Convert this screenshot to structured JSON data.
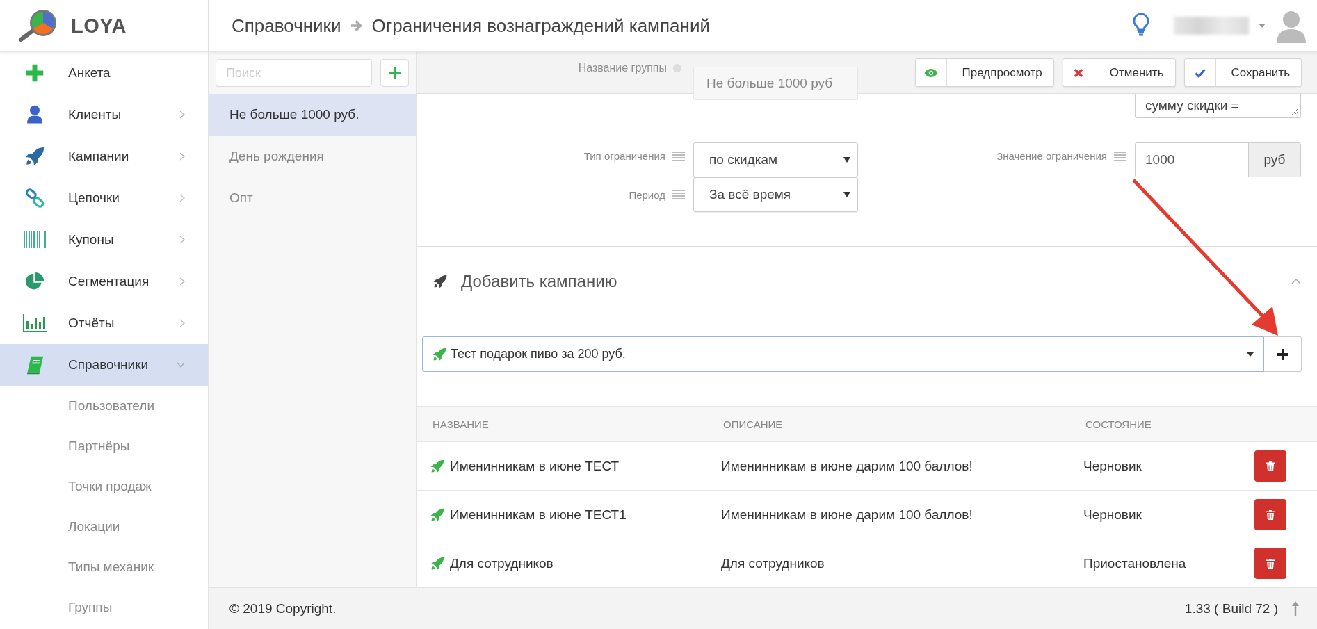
{
  "app": {
    "logo": "LOYA"
  },
  "header": {
    "breadcrumb": [
      {
        "label": "Справочники"
      },
      {
        "label": "Ограничения вознаграждений кампаний"
      }
    ]
  },
  "sidebar": {
    "items": [
      {
        "label": "Анкета",
        "kind": "link",
        "selected": false
      },
      {
        "label": "Клиенты",
        "kind": "menu",
        "selected": false,
        "expanded": false
      },
      {
        "label": "Кампании",
        "kind": "menu",
        "selected": false,
        "expanded": false
      },
      {
        "label": "Цепочки",
        "kind": "menu",
        "selected": false,
        "expanded": false
      },
      {
        "label": "Купоны",
        "kind": "menu",
        "selected": false,
        "expanded": false
      },
      {
        "label": "Сегментация",
        "kind": "menu",
        "selected": false,
        "expanded": false
      },
      {
        "label": "Отчёты",
        "kind": "menu",
        "selected": false,
        "expanded": false
      },
      {
        "label": "Справочники",
        "kind": "menu",
        "selected": true,
        "expanded": true,
        "children": [
          {
            "label": "Пользователи"
          },
          {
            "label": "Партнёры"
          },
          {
            "label": "Точки продаж"
          },
          {
            "label": "Локации"
          },
          {
            "label": "Типы механик"
          },
          {
            "label": "Группы"
          }
        ]
      }
    ]
  },
  "groups": {
    "search": {
      "placeholder": "Поиск"
    },
    "items": [
      {
        "label": "Не больше 1000 руб.",
        "selected": true
      },
      {
        "label": "День рождения",
        "selected": false
      },
      {
        "label": "Опт",
        "selected": false
      }
    ]
  },
  "toolbar": {
    "buttons": [
      {
        "kind": "preview",
        "label": "Предпросмотр"
      },
      {
        "kind": "cancel",
        "label": "Отменить"
      },
      {
        "kind": "save",
        "label": "Сохранить"
      }
    ]
  },
  "form": {
    "group_name": {
      "label": "Название группы",
      "value": "Не больше 1000 руб"
    },
    "description": {
      "value": "сумму скидки ="
    },
    "restriction_type": {
      "label": "Тип ограничения",
      "value": "по скидкам"
    },
    "period": {
      "label": "Период",
      "value": "За всё время"
    },
    "restriction_value": {
      "label": "Значение ограничения",
      "value": "1000",
      "unit": "руб"
    }
  },
  "add_campaign": {
    "title": "Добавить кампанию",
    "expanded": true,
    "selected_campaign": "Тест подарок пиво за 200 руб."
  },
  "table": {
    "columns": [
      "НАЗВАНИЕ",
      "ОПИСАНИЕ",
      "СОСТОЯНИЕ"
    ],
    "rows": [
      {
        "name": "Именинникам в июне ТЕСТ",
        "description": "Именинникам в июне дарим 100 баллов!",
        "status": "Черновик"
      },
      {
        "name": "Именинникам в июне ТЕСТ1",
        "description": "Именинникам в июне дарим 100 баллов!",
        "status": "Черновик"
      },
      {
        "name": "Для сотрудников",
        "description": "Для сотрудников",
        "status": "Приостановлена"
      }
    ]
  },
  "footer": {
    "copyright": "© 2019 Copyright.",
    "version": "1.33 ( Build 72 )"
  }
}
